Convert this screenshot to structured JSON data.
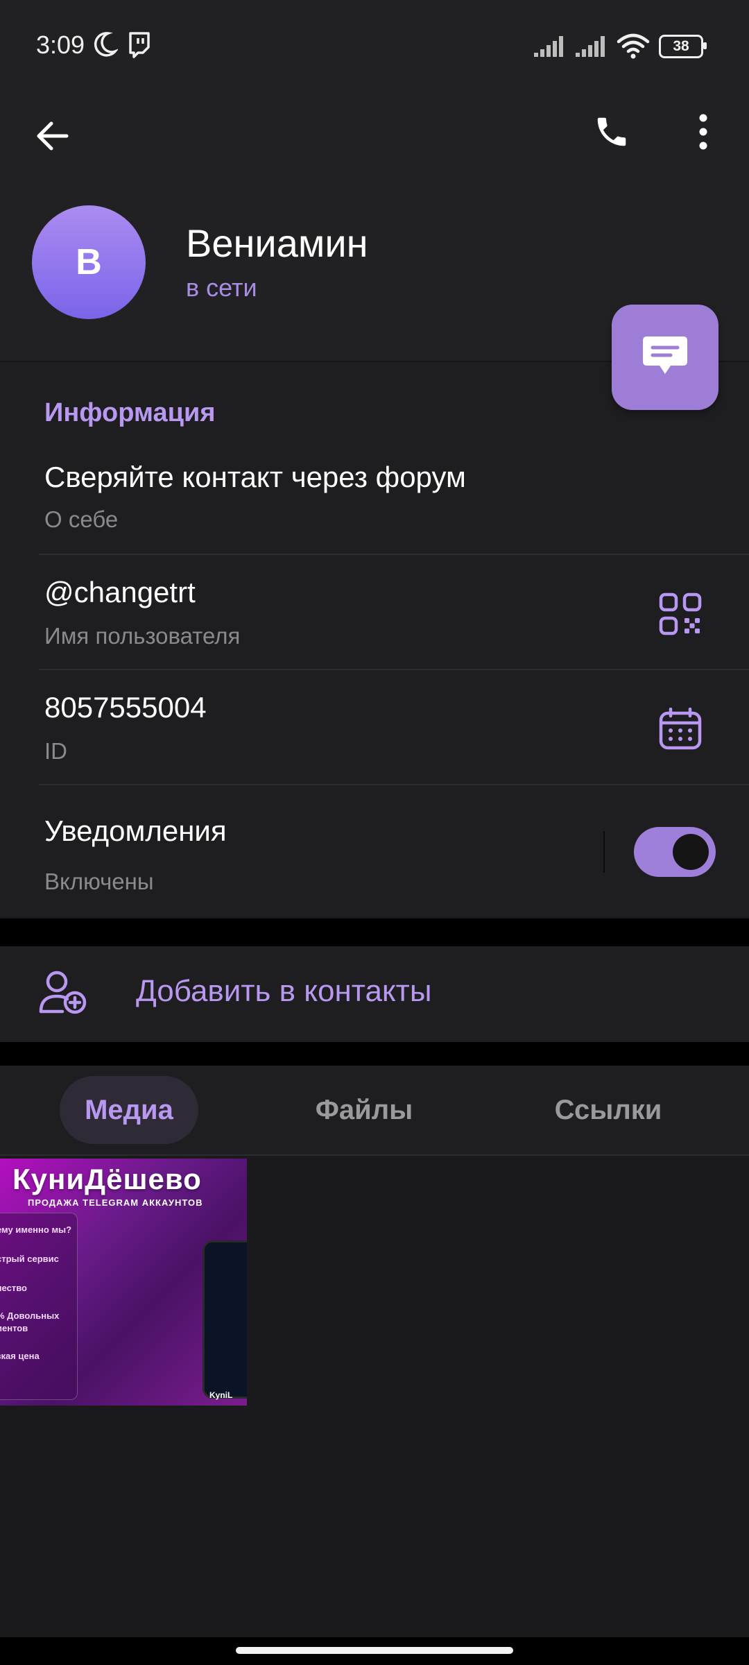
{
  "status_bar": {
    "time": "3:09",
    "battery": "38",
    "icons": [
      "moon-icon",
      "twitch-icon",
      "signal-icon",
      "signal-icon",
      "wifi-icon",
      "battery-icon"
    ]
  },
  "header": {
    "back_icon": "arrow-left-icon",
    "call_icon": "phone-icon",
    "menu_icon": "more-vertical-icon"
  },
  "profile": {
    "avatar_letter": "В",
    "name": "Вениамин",
    "status": "в сети",
    "fab_icon": "message-icon"
  },
  "info": {
    "header": "Информация",
    "bio": {
      "value": "Сверяйте контакт через форум",
      "label": "О себе"
    },
    "username": {
      "value": "@changetrt",
      "label": "Имя пользователя",
      "icon": "qr-code-icon"
    },
    "id": {
      "value": "8057555004",
      "label": "ID",
      "icon": "calendar-icon"
    },
    "notifications": {
      "value": "Уведомления",
      "label": "Включены",
      "enabled": true
    }
  },
  "add_contact": {
    "label": "Добавить в контакты",
    "icon": "add-user-icon"
  },
  "tabs": [
    {
      "label": "Медиа",
      "active": true
    },
    {
      "label": "Файлы",
      "active": false
    },
    {
      "label": "Ссылки",
      "active": false
    }
  ],
  "media": {
    "thumbnail": {
      "title": "КуниДёшево",
      "subtitle": "ПРОДАЖА  TELEGRAM  АККАУНТОВ",
      "lines": [
        "ему именно мы?",
        "стрый сервис",
        "чество",
        "% Довольных",
        "иентов",
        "зкая цена"
      ],
      "badge": "KyniL"
    }
  },
  "colors": {
    "accent": "#b898f0",
    "toggle": "#9e80da",
    "fab": "#9d7dd6",
    "background": "#1a1a1c"
  }
}
